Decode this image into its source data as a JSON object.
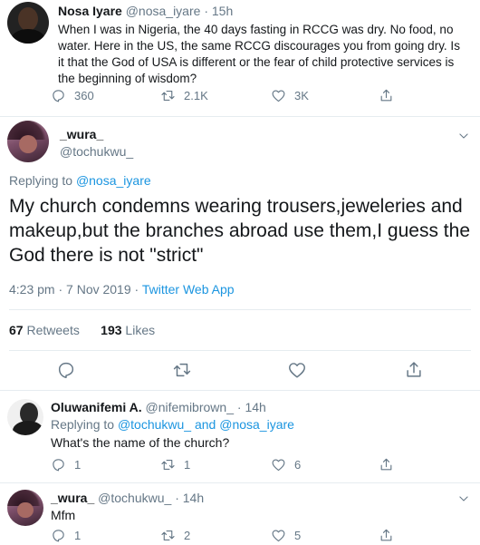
{
  "top_tweet": {
    "name": "Nosa Iyare",
    "handle": "@nosa_iyare",
    "sep": "·",
    "time": "15h",
    "text": "When I was in Nigeria, the 40 days fasting in RCCG was dry. No food, no water. Here in the US, the same RCCG discourages you from going dry. Is it that the God of USA is different or the fear of child protective services is the beginning of wisdom?",
    "replies": "360",
    "retweets": "2.1K",
    "likes": "3K"
  },
  "main_tweet": {
    "name": "_wura_",
    "handle": "@tochukwu_",
    "replying_prefix": "Replying to",
    "replying_to": "@nosa_iyare",
    "text": "My church condemns wearing trousers,jeweleries and makeup,but the branches abroad use them,I guess the God there is not \"strict\"",
    "time_date": "4:23 pm · 7 Nov 2019",
    "meta_sep": "·",
    "source": "Twitter Web App",
    "retweets_count": "67",
    "retweets_label": "Retweets",
    "likes_count": "193",
    "likes_label": "Likes"
  },
  "replies": [
    {
      "name": "Oluwanifemi A.",
      "handle": "@nifemibrown_",
      "sep": "·",
      "time": "14h",
      "replying_prefix": "Replying to",
      "replying_to_1": "@tochukwu_",
      "replying_and": "and",
      "replying_to_2": "@nosa_iyare",
      "text": "What's the name of the church?",
      "replies": "1",
      "retweets": "1",
      "likes": "6"
    },
    {
      "name": "_wura_",
      "handle": "@tochukwu_",
      "sep": "·",
      "time": "14h",
      "text": "Mfm",
      "replies": "1",
      "retweets": "2",
      "likes": "5"
    }
  ],
  "icons": [
    "reply-icon",
    "retweet-icon",
    "like-icon",
    "share-icon",
    "chevron-down-icon"
  ],
  "colors": {
    "link": "#1b95e0",
    "muted": "#657786",
    "text": "#14171a",
    "divider": "#e6ecf0"
  }
}
